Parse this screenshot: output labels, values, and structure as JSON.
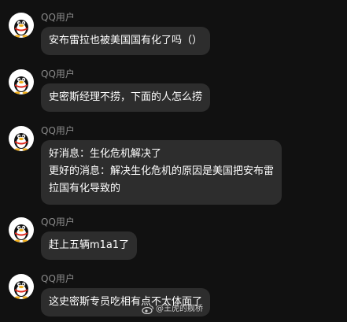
{
  "messages": [
    {
      "sender": "QQ用户",
      "lines": [
        "安布雷拉也被美国国有化了吗（）"
      ]
    },
    {
      "sender": "QQ用户",
      "lines": [
        "史密斯经理不捞，下面的人怎么捞"
      ]
    },
    {
      "sender": "QQ用户",
      "lines": [
        "好消息：生化危机解决了",
        "更好的消息：解决生化危机的原因是美国把安布雷",
        "拉国有化导致的"
      ]
    },
    {
      "sender": "QQ用户",
      "lines": [
        "赶上五辆m1a1了"
      ]
    },
    {
      "sender": "QQ用户",
      "lines": [
        "这史密斯专员吃相有点不太体面了"
      ]
    }
  ],
  "watermark": {
    "text": "@王虎的舰桥",
    "icon": "weibo-icon"
  },
  "colors": {
    "background": "#111111",
    "bubble": "#2d2d2d",
    "sender": "#8a8a8a",
    "text": "#ffffff"
  }
}
